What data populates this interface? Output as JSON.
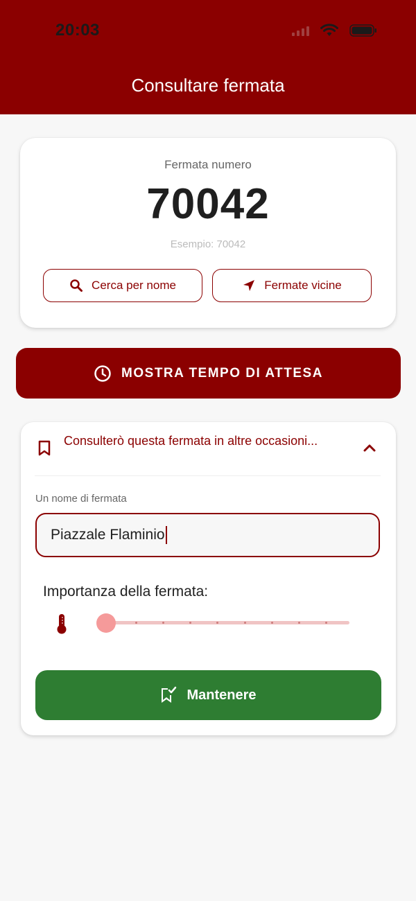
{
  "status_bar": {
    "time": "20:03"
  },
  "header": {
    "title": "Consultare fermata"
  },
  "stop_card": {
    "label": "Fermata numero",
    "number": "70042",
    "hint": "Esempio: 70042",
    "search_button": "Cerca per nome",
    "nearby_button": "Fermate vicine"
  },
  "wait_button": {
    "label": "MOSTRA TEMPO DI ATTESA"
  },
  "favorite": {
    "header": "Consulterò questa fermata in altre occasioni...",
    "name_label": "Un nome di fermata",
    "name_value": "Piazzale Flaminio",
    "importance_label": "Importanza della fermata:",
    "importance_level": 0,
    "importance_max": 8,
    "save_button": "Mantenere"
  },
  "colors": {
    "brand": "#8b0000",
    "save": "#2e7d32"
  },
  "icons": {
    "search": "search-icon",
    "nearby": "navigation-arrow-icon",
    "clock": "clock-icon",
    "bookmark": "bookmark-icon",
    "chevron": "chevron-up-icon",
    "thermometer": "thermometer-icon",
    "save": "bookmark-check-icon"
  }
}
